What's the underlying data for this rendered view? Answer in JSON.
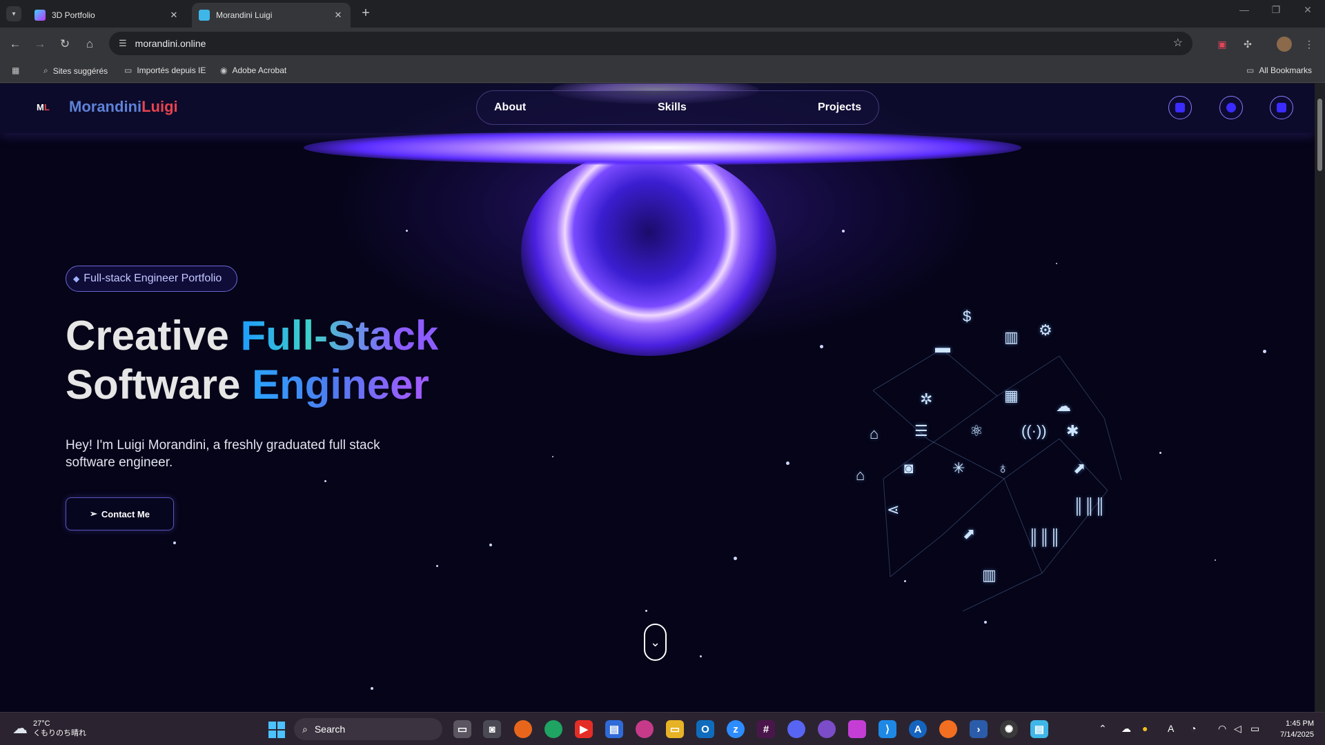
{
  "browser": {
    "tabs": [
      {
        "title": "3D Portfolio",
        "active": false
      },
      {
        "title": "Morandini Luigi",
        "active": true
      }
    ],
    "new_tab_glyph": "+",
    "url": "morandini.online",
    "bookmarks": [
      {
        "label": "Sites suggérés",
        "icon": "search-icon"
      },
      {
        "label": "Importés depuis IE",
        "icon": "folder-icon"
      },
      {
        "label": "Adobe Acrobat",
        "icon": "acrobat-icon"
      }
    ],
    "all_bookmarks": "All Bookmarks"
  },
  "site": {
    "logo_mark_a": "M",
    "logo_mark_b": "L",
    "brand_first": "Morandini",
    "brand_last": "Luigi",
    "nav": [
      "About",
      "Skills",
      "Projects"
    ],
    "badge": "Full-stack Engineer Portfolio",
    "hero": {
      "line1_plain": "Creative ",
      "line1_accent": "Full-Stack",
      "line2_plain": "Software ",
      "line2_accent": "Engineer"
    },
    "intro": "Hey! I'm Luigi Morandini, a freshly graduated full stack software engineer.",
    "cta": "Contact Me",
    "colors": {
      "brand_first": "#5d82d8",
      "brand_last": "#e8434f",
      "accent_start": "#1e9bff",
      "accent_end": "#8c5cff"
    }
  },
  "taskbar": {
    "weather_temp": "27°C",
    "weather_desc": "くもりのち晴れ",
    "search_placeholder": "Search",
    "time": "1:45 PM",
    "date": "7/14/2025",
    "ime": "A"
  }
}
